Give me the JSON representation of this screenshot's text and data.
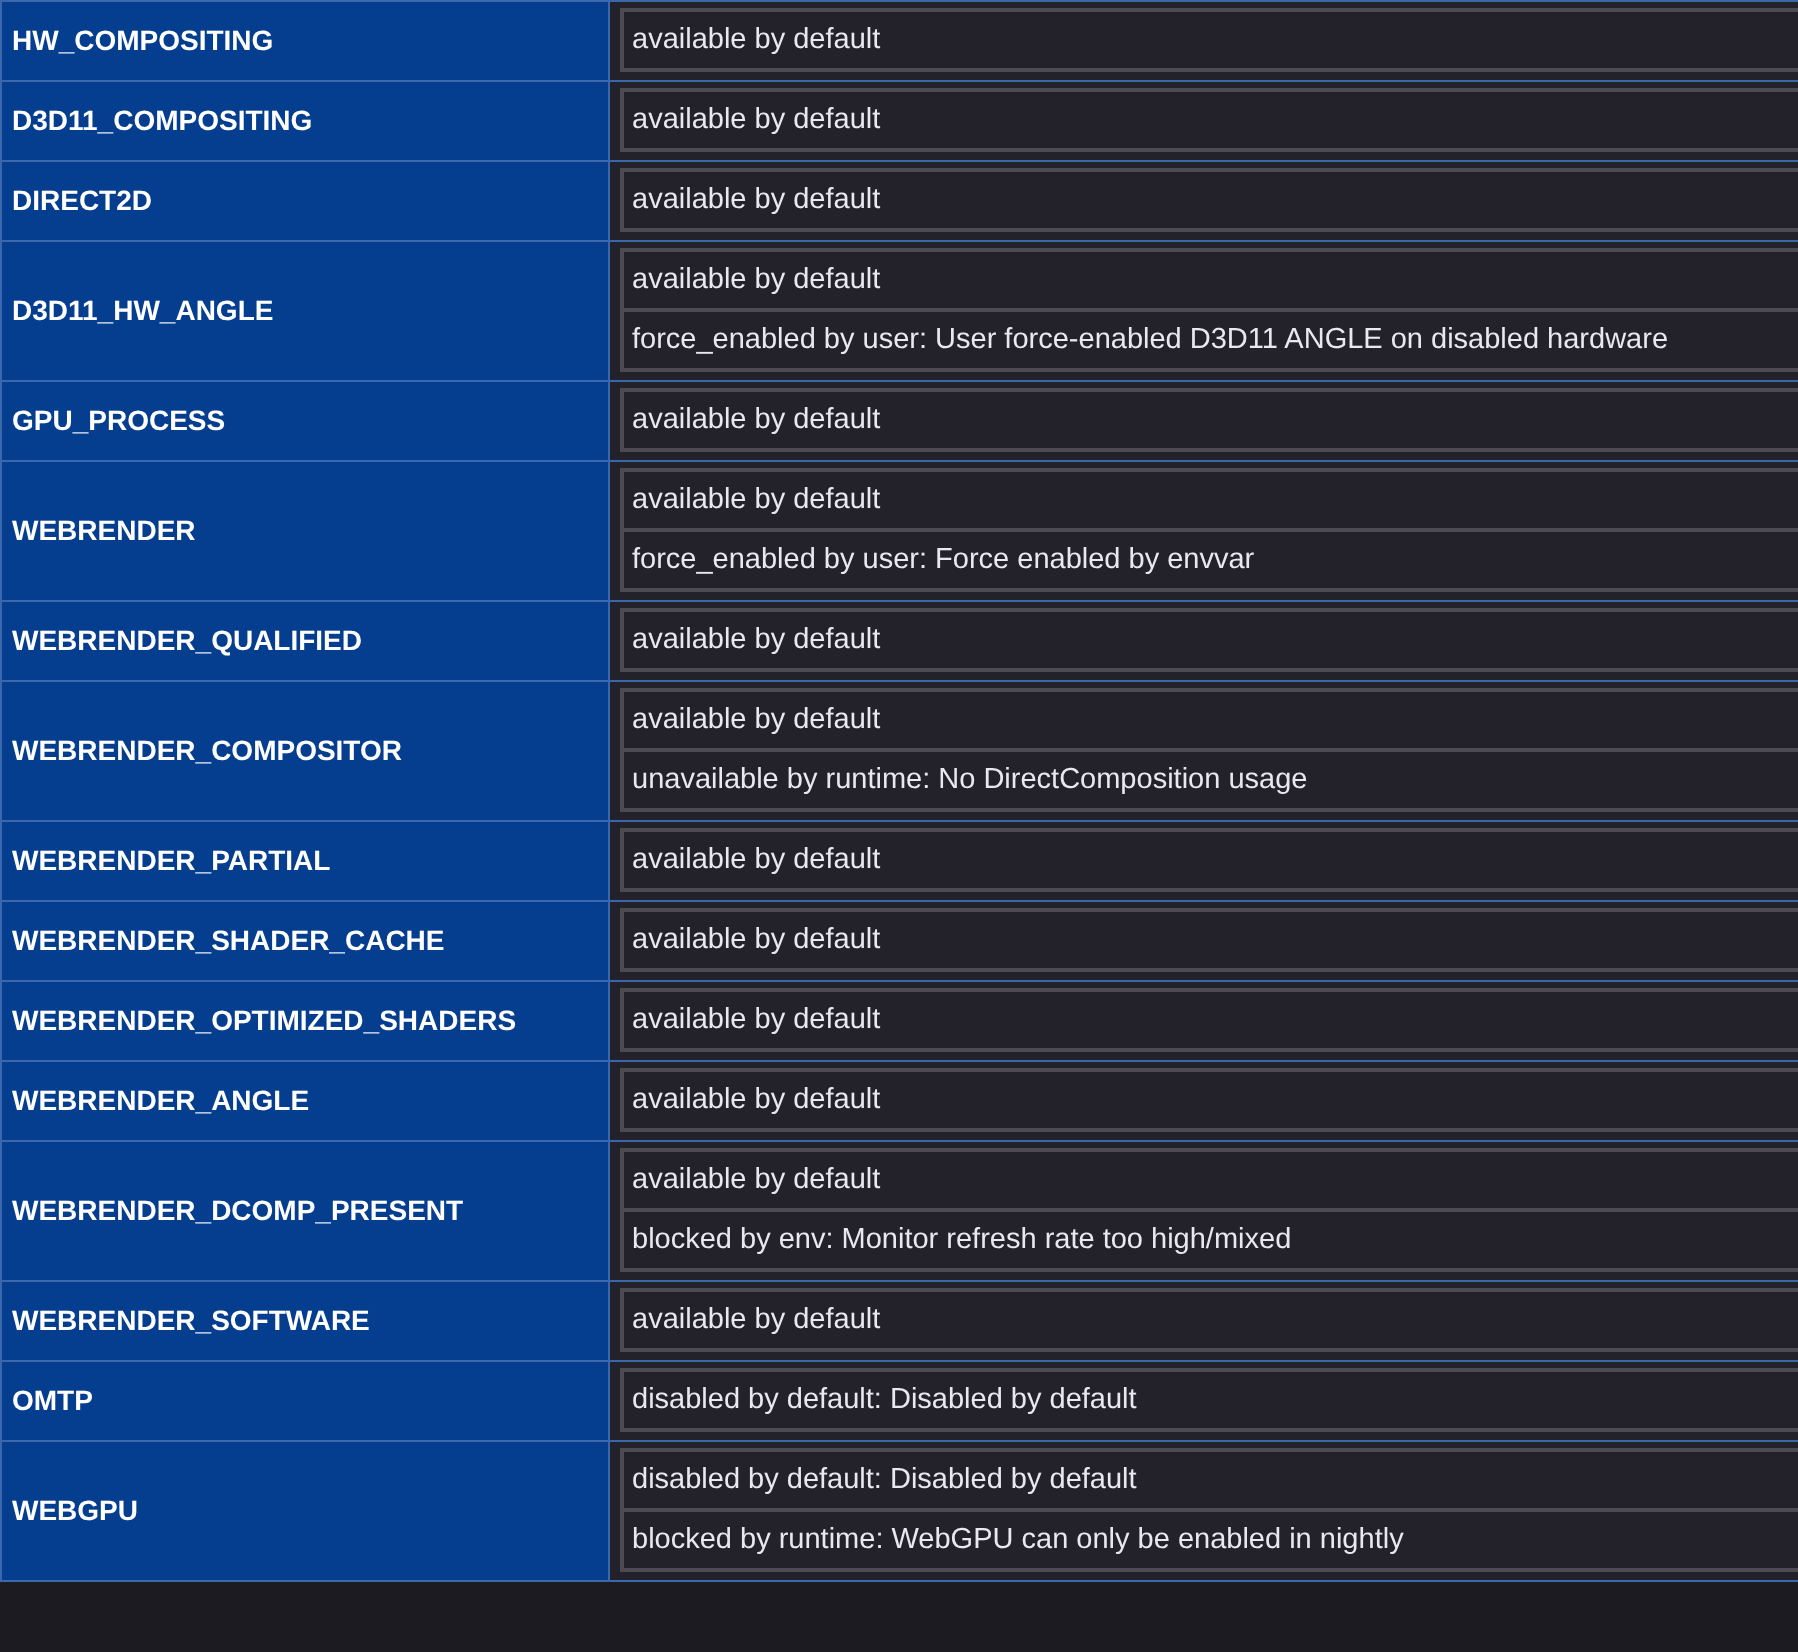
{
  "features": [
    {
      "name": "HW_COMPOSITING",
      "status": [
        "available by default"
      ]
    },
    {
      "name": "D3D11_COMPOSITING",
      "status": [
        "available by default"
      ]
    },
    {
      "name": "DIRECT2D",
      "status": [
        "available by default"
      ]
    },
    {
      "name": "D3D11_HW_ANGLE",
      "status": [
        "available by default",
        "force_enabled by user: User force-enabled D3D11 ANGLE on disabled hardware"
      ]
    },
    {
      "name": "GPU_PROCESS",
      "status": [
        "available by default"
      ]
    },
    {
      "name": "WEBRENDER",
      "status": [
        "available by default",
        "force_enabled by user: Force enabled by envvar"
      ]
    },
    {
      "name": "WEBRENDER_QUALIFIED",
      "status": [
        "available by default"
      ]
    },
    {
      "name": "WEBRENDER_COMPOSITOR",
      "status": [
        "available by default",
        "unavailable by runtime: No DirectComposition usage"
      ]
    },
    {
      "name": "WEBRENDER_PARTIAL",
      "status": [
        "available by default"
      ]
    },
    {
      "name": "WEBRENDER_SHADER_CACHE",
      "status": [
        "available by default"
      ]
    },
    {
      "name": "WEBRENDER_OPTIMIZED_SHADERS",
      "status": [
        "available by default"
      ]
    },
    {
      "name": "WEBRENDER_ANGLE",
      "status": [
        "available by default"
      ]
    },
    {
      "name": "WEBRENDER_DCOMP_PRESENT",
      "status": [
        "available by default",
        "blocked by env: Monitor refresh rate too high/mixed"
      ]
    },
    {
      "name": "WEBRENDER_SOFTWARE",
      "status": [
        "available by default"
      ]
    },
    {
      "name": "OMTP",
      "status": [
        "disabled by default: Disabled by default"
      ]
    },
    {
      "name": "WEBGPU",
      "status": [
        "disabled by default: Disabled by default",
        "blocked by runtime: WebGPU can only be enabled in nightly"
      ]
    }
  ]
}
